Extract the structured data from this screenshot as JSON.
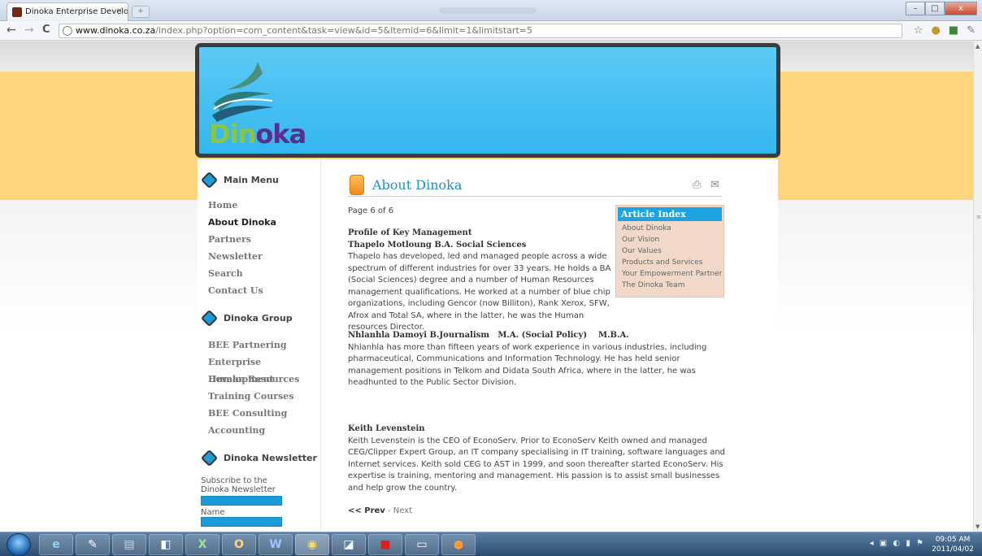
{
  "browser": {
    "tab_title": "Dinoka Enterprise Develo...",
    "tab_close": "×",
    "url_domain": "www.dinoka.co.za",
    "url_path": "/index.php?option=com_content&task=view&id=5&Itemid=6&limit=1&limitstart=5",
    "back_icon": "←",
    "forward_icon": "→",
    "reload_icon": "C",
    "star_icon": "☆",
    "wrench_icon": "🔧"
  },
  "site": {
    "logo_part1": "Din",
    "logo_part2": "oka",
    "colors": {
      "header_blue": "#34b6ef",
      "accent_blue": "#1b91c9",
      "yellow_band": "#fdd57c",
      "logo_green": "#8cc63f",
      "logo_purple": "#5b2d8c"
    }
  },
  "sidebar": {
    "main_menu_title": "Main Menu",
    "main_menu": [
      "Home",
      "About Dinoka",
      "Partners",
      "Newsletter",
      "Search",
      "Contact Us"
    ],
    "active_item": "About Dinoka",
    "group_title": "Dinoka Group",
    "group_menu": [
      "BEE Partnering",
      "Enterprise Development",
      "Human Resources",
      "Training Courses",
      "BEE Consulting",
      "Accounting"
    ],
    "newsletter_title": "Dinoka Newsletter",
    "subscribe_text": "Subscribe to the Dinoka Newsletter",
    "name_label": "Name"
  },
  "article": {
    "title": "About Dinoka",
    "page_info": "Page 6 of 6",
    "section_heading": "Profile of Key Management",
    "person1_name": "Thapelo Motloung B.A. Social Sciences",
    "person1_body": "Thapelo has developed, led and managed people across a wide spectrum of different industries for over 33 years. He holds a BA (Social Sciences) degree and a number of Human Resources management qualifications. He worked at a number of blue chip organizations, including Gencor (now Billiton), Rank Xerox, SFW, Afrox and Total SA, where in the latter, he was the Human resources Director.",
    "person2_name": "Nhlanhla Damoyi B.Journalism   M.A. (Social Policy)    M.B.A.",
    "person2_body": "Nhlanhla has more than fifteen years of work experience in various industries, including pharmaceutical, Communications and Information Technology. He has held senior management positions in Telkom and Didata South Africa, where in the latter, he was headhunted to the Public Sector Division.",
    "person3_name": "Keith Levenstein",
    "person3_body": "Keith Levenstein is the CEO of EconoServ. Prior to EconoServ Keith owned and managed CEG/Clipper Expert Group, an IT company specialising in IT training, software languages and Internet services. Keith sold CEG to AST in 1999, and soon thereafter started EconoServ. His expertise is training, mentoring and management. His passion is to assist small businesses and help grow the country.",
    "prev_label": "<< Prev",
    "sep": " - ",
    "next_label": "Next",
    "pdf_icon": "pdf-icon",
    "print_icon": "print-icon"
  },
  "article_index": {
    "title": "Article Index",
    "items": [
      "About Dinoka",
      "Our Vision",
      "Our Values",
      "Products and Services",
      "Your Empowerment Partner",
      "The Dinoka Team"
    ]
  },
  "taskbar": {
    "time": "09:05 AM",
    "date": "2011/04/02"
  }
}
